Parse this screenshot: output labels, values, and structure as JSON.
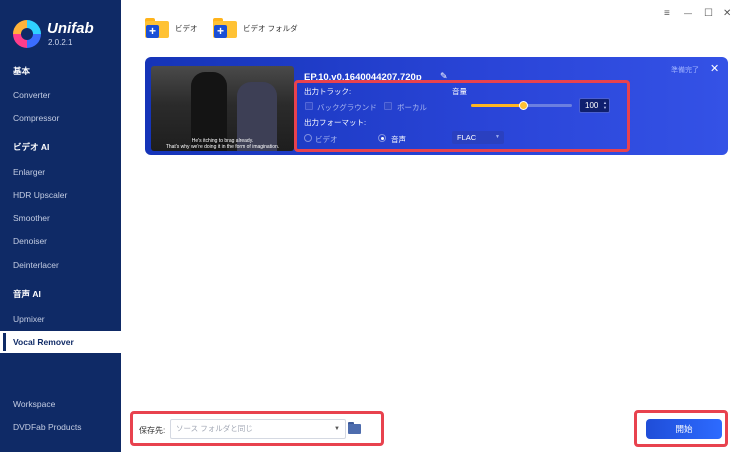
{
  "app": {
    "brand": "Unifab",
    "version": "2.0.2.1"
  },
  "sidebar": {
    "sections": [
      {
        "title": "基本"
      },
      {
        "title": "ビデオ AI"
      },
      {
        "title": "音声 AI"
      }
    ],
    "items": [
      {
        "label": "Converter"
      },
      {
        "label": "Compressor"
      },
      {
        "label": "Enlarger"
      },
      {
        "label": "HDR Upscaler"
      },
      {
        "label": "Smoother"
      },
      {
        "label": "Denoiser"
      },
      {
        "label": "Deinterlacer"
      },
      {
        "label": "Upmixer"
      },
      {
        "label": "Vocal Remover"
      },
      {
        "label": "Workspace"
      },
      {
        "label": "DVDFab Products"
      }
    ],
    "active": "Vocal Remover"
  },
  "toolbar": {
    "add_video_label": "ビデオ",
    "add_folder_label": "ビデオ フォルダ"
  },
  "window_controls": {
    "menu": "≡",
    "minimize": "—",
    "maximize": "☐",
    "close": "✕"
  },
  "task": {
    "filename": "EP.10.v0.1640044207.720p",
    "status": "準備完了",
    "thumbnail_subtitle_1": "He's itching to brag already.",
    "thumbnail_subtitle_2": "That's why we're doing it in the form of imagination.",
    "output_track_label": "出力トラック:",
    "track_options": [
      {
        "label": "バックグラウンド",
        "checked": false
      },
      {
        "label": "ボーカル",
        "checked": false
      }
    ],
    "volume_label": "音量",
    "volume_value": "100",
    "volume_level": 0.52,
    "output_format_label": "出力フォーマット:",
    "format_options": [
      {
        "label": "ビデオ",
        "selected": false
      },
      {
        "label": "音声",
        "selected": true
      }
    ],
    "format_selected": "FLAC"
  },
  "bottom": {
    "save_label": "保存先:",
    "save_placeholder": "ソース フォルダと同じ",
    "start_label": "開始"
  },
  "colors": {
    "sidebar_bg": "#0f2a66",
    "card_bg": "#1f3cc8",
    "accent": "#ffb522",
    "highlight": "#e8424e",
    "start_button": "#2d6bff"
  }
}
